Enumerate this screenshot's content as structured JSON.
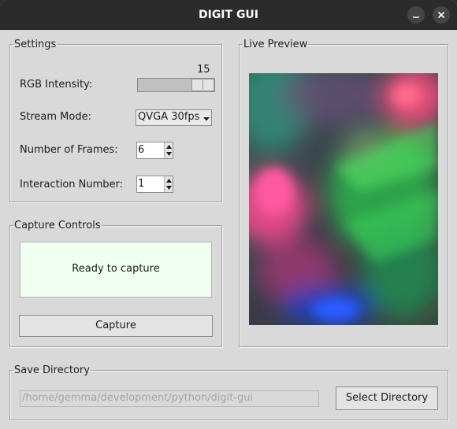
{
  "window": {
    "title": "DIGIT GUI"
  },
  "settings": {
    "legend": "Settings",
    "rgb_intensity": {
      "label": "RGB Intensity:",
      "value": "15",
      "level": 15,
      "max": 15
    },
    "stream_mode": {
      "label": "Stream Mode:",
      "selected": "QVGA 30fps"
    },
    "frames": {
      "label": "Number of Frames:",
      "value": "6"
    },
    "interaction": {
      "label": "Interaction Number:",
      "value": "1"
    }
  },
  "capture": {
    "legend": "Capture Controls",
    "status": "Ready to capture",
    "status_bg": "#f0fff0",
    "button_label": "Capture"
  },
  "preview": {
    "legend": "Live Preview"
  },
  "save": {
    "legend": "Save Directory",
    "path": "/home/gemma/development/python/digit-gui",
    "button_label": "Select Directory"
  },
  "icons": {
    "minimize": "minimize-icon",
    "close": "close-icon",
    "dropdown": "chevron-down-icon",
    "spin": "spin-arrows-icon"
  }
}
